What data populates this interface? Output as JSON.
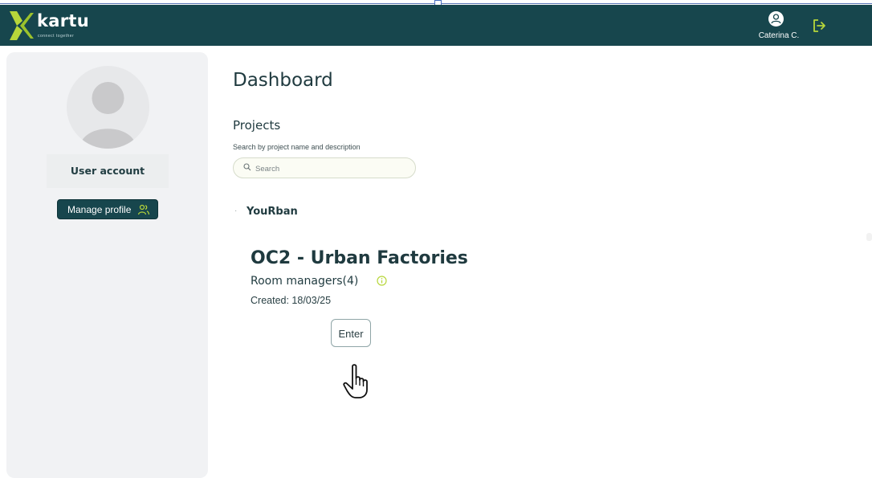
{
  "header": {
    "logo_text": "kartu",
    "logo_tagline": "connect together",
    "user_name": "Caterina C.",
    "icons": {
      "logo": "k-logo-icon",
      "user": "user-circle-icon",
      "logout": "logout-icon"
    }
  },
  "sidebar": {
    "account_label": "User account",
    "manage_profile_label": "Manage profile",
    "icons": {
      "avatar": "avatar-placeholder-icon",
      "manage": "users-icon"
    }
  },
  "main": {
    "title": "Dashboard",
    "projects_heading": "Projects",
    "search": {
      "label": "Search by project name and description",
      "placeholder": "Search",
      "icon": "search-icon"
    },
    "group": {
      "name": "YouRban",
      "project": {
        "title": "OC2 - Urban Factories",
        "room_managers": "Room managers(4)",
        "created": "Created: 18/03/25",
        "enter_label": "Enter",
        "info_icon": "info-icon"
      }
    }
  },
  "colors": {
    "navbar": "#17464d",
    "accent_green": "#b7d63a",
    "sidebar_bg": "#f1f2f4",
    "text_primary": "#1f3a3f"
  },
  "cursor": "hand-pointer-icon"
}
